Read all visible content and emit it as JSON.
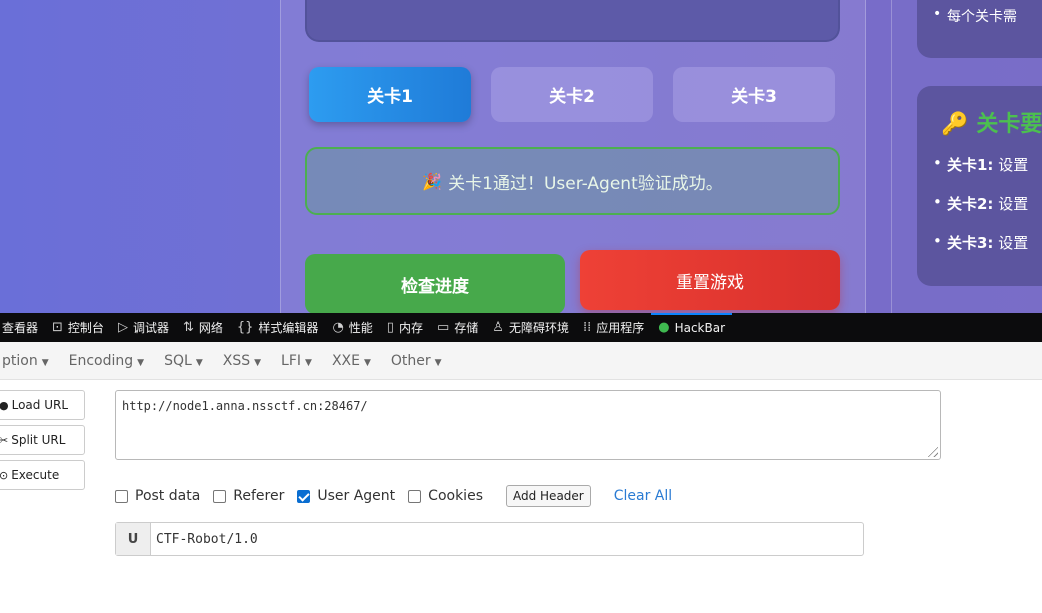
{
  "webpage": {
    "levels": [
      {
        "label": "关卡1",
        "active": true
      },
      {
        "label": "关卡2",
        "active": false
      },
      {
        "label": "关卡3",
        "active": false
      }
    ],
    "message": {
      "emoji": "🎉",
      "text": "关卡1通过！User-Agent验证成功。"
    },
    "check_button": "检查进度",
    "reset_button": "重置游戏",
    "side": {
      "top_item": "每个关卡需",
      "title_icon": "🔑",
      "title": "关卡要",
      "items": [
        {
          "label": "关卡1:",
          "text": "设置"
        },
        {
          "label": "关卡2:",
          "text": "设置"
        },
        {
          "label": "关卡3:",
          "text": "设置"
        }
      ]
    }
  },
  "devtools": {
    "tabs": [
      {
        "label": "查看器",
        "icon": "inspector-icon"
      },
      {
        "label": "控制台",
        "icon": "console-icon"
      },
      {
        "label": "调试器",
        "icon": "debugger-icon"
      },
      {
        "label": "网络",
        "icon": "network-icon"
      },
      {
        "label": "样式编辑器",
        "icon": "style-editor-icon"
      },
      {
        "label": "性能",
        "icon": "performance-icon"
      },
      {
        "label": "内存",
        "icon": "memory-icon"
      },
      {
        "label": "存储",
        "icon": "storage-icon"
      },
      {
        "label": "无障碍环境",
        "icon": "accessibility-icon"
      },
      {
        "label": "应用程序",
        "icon": "application-icon"
      },
      {
        "label": "HackBar",
        "icon": "hackbar-icon"
      }
    ]
  },
  "hackbar": {
    "menu": [
      "ption",
      "Encoding",
      "SQL",
      "XSS",
      "LFI",
      "XXE",
      "Other"
    ],
    "buttons": {
      "load": "Load URL",
      "split": "Split URL",
      "execute": "Execute"
    },
    "url": "http://node1.anna.nssctf.cn:28467/",
    "options": {
      "post_data": "Post data",
      "referer": "Referer",
      "user_agent": "User Agent",
      "cookies": "Cookies",
      "user_agent_checked": true
    },
    "add_header": "Add Header",
    "clear_all": "Clear All",
    "header_row": {
      "prefix": "U",
      "value": "CTF-Robot/1.0"
    }
  }
}
